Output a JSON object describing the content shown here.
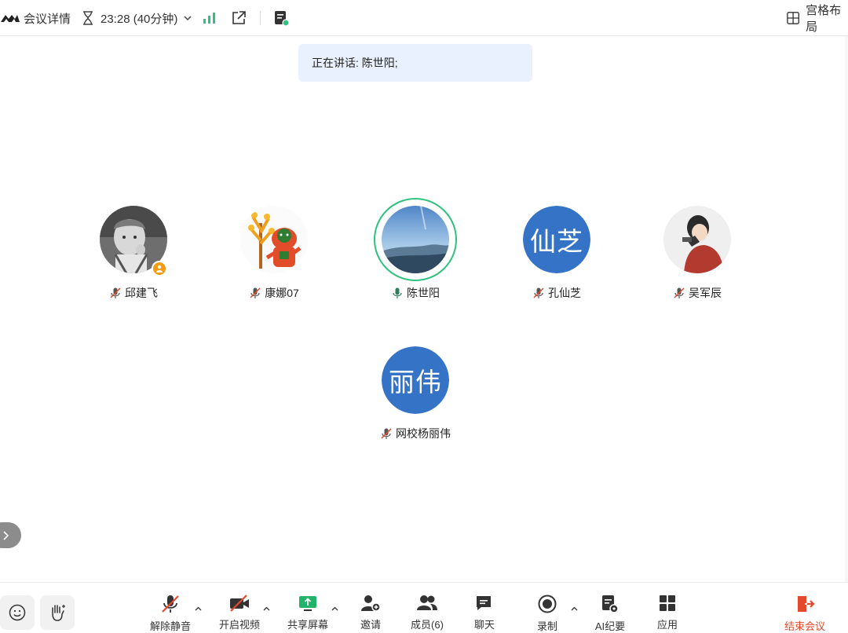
{
  "topbar": {
    "meeting_details": "会议详情",
    "timer": "23:28 (40分钟)",
    "layout_label": "宫格布局"
  },
  "speaking_banner": "正在讲话: 陈世阳;",
  "participants": [
    {
      "name": "邱建飞",
      "avatar": "photo-child",
      "muted": true,
      "host": true
    },
    {
      "name": "康娜07",
      "avatar": "photo-cartoon",
      "muted": true
    },
    {
      "name": "陈世阳",
      "avatar": "photo-landscape",
      "muted": false,
      "speaking": true
    },
    {
      "name": "孔仙芝",
      "avatar_text": "仙芝",
      "muted": true
    },
    {
      "name": "吴军辰",
      "avatar": "photo-man",
      "muted": true
    },
    {
      "name": "网校杨丽伟",
      "avatar_text": "丽伟",
      "muted": true
    }
  ],
  "toolbar": {
    "unmute": "解除静音",
    "start_video": "开启视频",
    "share_screen": "共享屏幕",
    "invite": "邀请",
    "members": "成员(6)",
    "chat": "聊天",
    "record": "录制",
    "ai_minutes": "AI纪要",
    "apps": "应用",
    "end_meeting": "结束会议"
  },
  "colors": {
    "accent_green": "#2ec27e",
    "avatar_blue": "#3573c7",
    "end_red": "#e5492d",
    "banner_bg": "#e8f1fd",
    "host_badge": "#f39b13"
  }
}
